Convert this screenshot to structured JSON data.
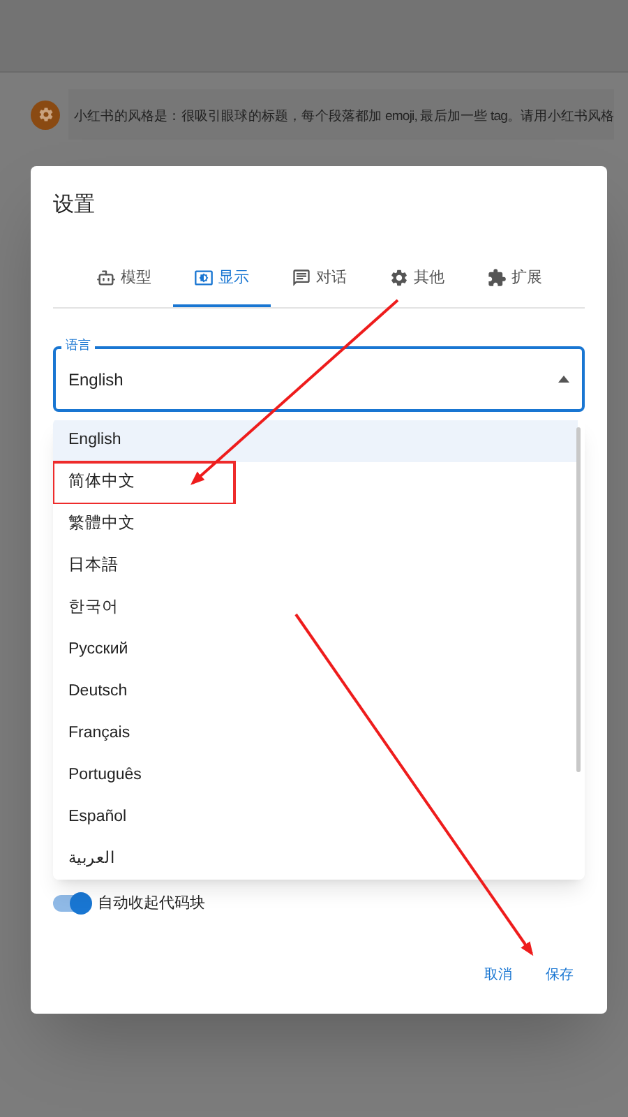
{
  "background": {
    "message": "小红书的风格是：很吸引眼球的标题，每个段落都加 emoji, 最后加一些 tag。请用小红书风格"
  },
  "dialog": {
    "title": "设置",
    "tabs": [
      {
        "label": "模型",
        "selected": false
      },
      {
        "label": "显示",
        "selected": true
      },
      {
        "label": "对话",
        "selected": false
      },
      {
        "label": "其他",
        "selected": false
      },
      {
        "label": "扩展",
        "selected": false
      }
    ],
    "language_field": {
      "label": "语言",
      "value": "English",
      "expanded": true
    },
    "language_menu": [
      {
        "label": "English",
        "selected": true,
        "highlighted": false
      },
      {
        "label": "简体中文",
        "selected": false,
        "highlighted": true
      },
      {
        "label": "繁體中文",
        "selected": false,
        "highlighted": false
      },
      {
        "label": "日本語",
        "selected": false,
        "highlighted": false
      },
      {
        "label": "한국어",
        "selected": false,
        "highlighted": false
      },
      {
        "label": "Русский",
        "selected": false,
        "highlighted": false
      },
      {
        "label": "Deutsch",
        "selected": false,
        "highlighted": false
      },
      {
        "label": "Français",
        "selected": false,
        "highlighted": false
      },
      {
        "label": "Português",
        "selected": false,
        "highlighted": false
      },
      {
        "label": "Español",
        "selected": false,
        "highlighted": false
      },
      {
        "label": "العربية",
        "selected": false,
        "highlighted": false
      }
    ],
    "toggle": {
      "label": "自动收起代码块",
      "on": true
    },
    "buttons": [
      "取消",
      "保存"
    ]
  }
}
